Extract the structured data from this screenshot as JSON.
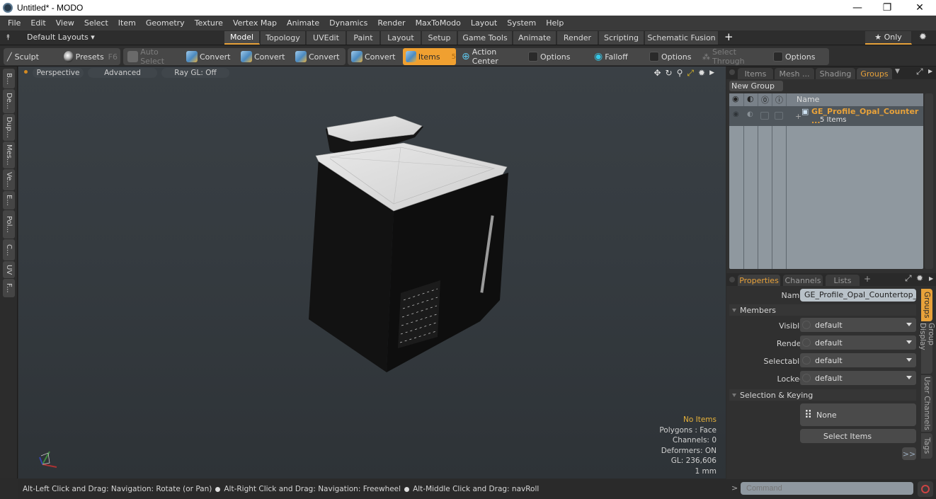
{
  "window": {
    "title": "Untitled* - MODO",
    "minimize": "—",
    "maximize": "❐",
    "close": "✕"
  },
  "menu": [
    "File",
    "Edit",
    "View",
    "Select",
    "Item",
    "Geometry",
    "Texture",
    "Vertex Map",
    "Animate",
    "Dynamics",
    "Render",
    "MaxToModo",
    "Layout",
    "System",
    "Help"
  ],
  "layouts": {
    "dropdown": "Default Layouts ▾",
    "tabs": [
      "Model",
      "Topology",
      "UVEdit",
      "Paint",
      "Layout",
      "Setup",
      "Game Tools",
      "Animate",
      "Render",
      "Scripting",
      "Schematic Fusion"
    ],
    "active_tab": "Model",
    "add": "+",
    "only": "★  Only"
  },
  "toolbar": {
    "sculpt": "Sculpt",
    "presets": "Presets",
    "presets_key": "F6",
    "auto_select": "Auto Select",
    "convert1": "Convert",
    "convert2": "Convert",
    "convert3": "Convert",
    "convert4": "Convert",
    "items": "Items",
    "items_key": "5",
    "action_center": "Action Center",
    "options1": "Options",
    "falloff": "Falloff",
    "options2": "Options",
    "select_through": "Select Through",
    "options3": "Options"
  },
  "left_strip": [
    "B...",
    "De...",
    "Dup...",
    "Mes...",
    "Ve...",
    "E...",
    "Pol...",
    "C...",
    "UV",
    "F..."
  ],
  "viewport": {
    "perspective": "Perspective",
    "advanced": "Advanced",
    "raygl": "Ray GL: Off",
    "stats": {
      "items": "No Items",
      "polygons": "Polygons : Face",
      "channels": "Channels: 0",
      "deformers": "Deformers: ON",
      "gl": "GL: 236,606",
      "unit": "1 mm"
    }
  },
  "status": {
    "part1": "Alt-Left Click and Drag: Navigation: Rotate (or Pan)",
    "part2": "Alt-Right Click and Drag: Navigation: Freewheel",
    "part3": "Alt-Middle Click and Drag: navRoll"
  },
  "top_panel": {
    "tabs": [
      "Items",
      "Mesh ...",
      "Shading",
      "Groups"
    ],
    "active_tab": "Groups",
    "new_group": "New Group",
    "column_name": "Name",
    "group": {
      "name": "GE_Profile_Opal_Counter ...",
      "count": "5 Items"
    }
  },
  "properties": {
    "tabs": [
      "Properties",
      "Channels",
      "Lists"
    ],
    "active_tab": "Properties",
    "add": "+",
    "name_label": "Name",
    "name_value": "GE_Profile_Opal_Countertop_Nu",
    "members_section": "Members",
    "fields": [
      {
        "label": "Visible",
        "value": "default"
      },
      {
        "label": "Render",
        "value": "default"
      },
      {
        "label": "Selectable",
        "value": "default"
      },
      {
        "label": "Locked",
        "value": "default"
      }
    ],
    "selection_section": "Selection & Keying",
    "none_button": "None",
    "select_items": "Select Items",
    "more": ">>",
    "side_tabs": [
      "Groups",
      "Group Display",
      "User Channels",
      "Tags"
    ],
    "active_side_tab": "Groups"
  },
  "command": {
    "prompt": ">",
    "placeholder": "Command"
  },
  "colors": {
    "accent": "#e8a23a",
    "panel": "#303030",
    "viewport": "#353b40"
  }
}
